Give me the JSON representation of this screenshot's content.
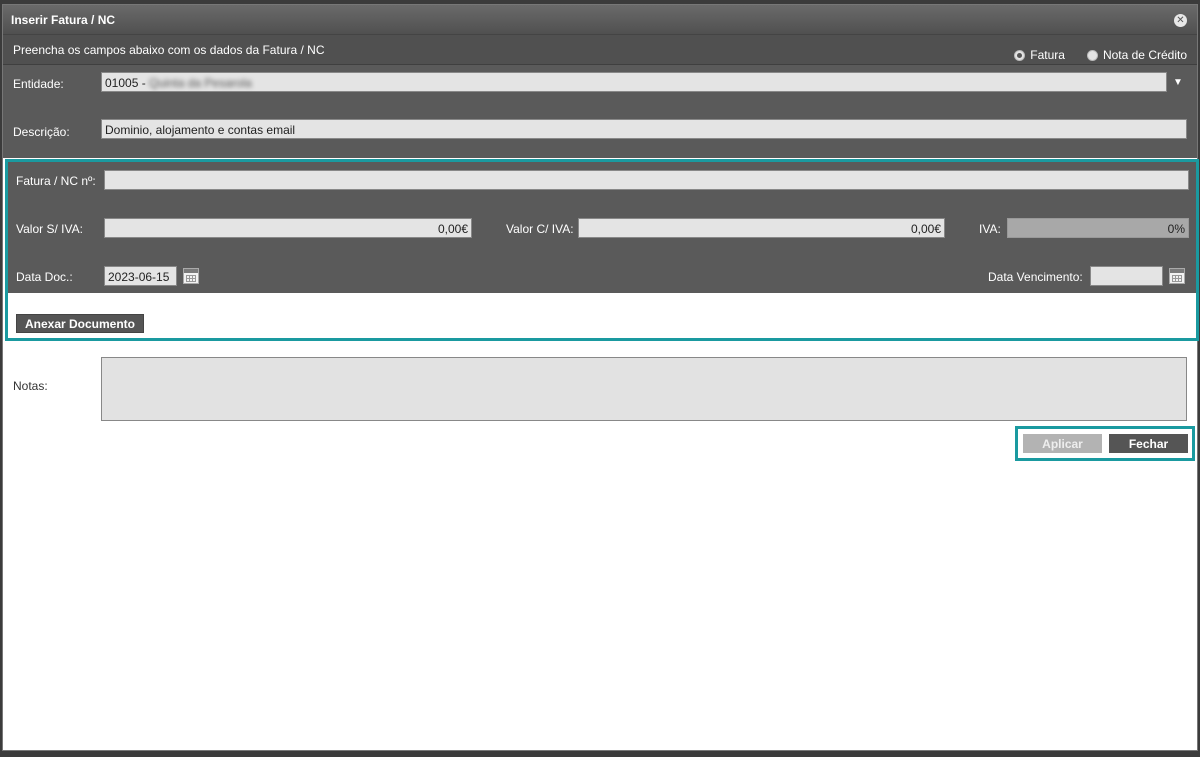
{
  "dialog": {
    "title": "Inserir Fatura / NC",
    "close_symbol": "✕"
  },
  "header": {
    "instructions": "Preencha os campos abaixo com os dados da Fatura / NC",
    "radio_options": [
      {
        "label": "Fatura",
        "selected": true
      },
      {
        "label": "Nota de Crédito",
        "selected": false
      }
    ]
  },
  "entity": {
    "label": "Entidade:",
    "code": "01005 -",
    "name_redacted": "Quinta da Pesarola"
  },
  "description": {
    "label": "Descrição:",
    "value": "Dominio, alojamento e contas email"
  },
  "invoice": {
    "number_label": "Fatura / NC nº:",
    "number_value": "",
    "value_excl_label": "Valor S/ IVA:",
    "value_excl": "0,00€",
    "value_incl_label": "Valor C/ IVA:",
    "value_incl": "0,00€",
    "vat_label": "IVA:",
    "vat_value": "0%",
    "doc_date_label": "Data Doc.:",
    "doc_date": "2023-06-15",
    "due_date_label": "Data Vencimento:",
    "due_date": "",
    "attach_label": "Anexar Documento"
  },
  "notes": {
    "label": "Notas:",
    "value": ""
  },
  "actions": {
    "apply_label": "Aplicar",
    "close_label": "Fechar"
  },
  "colors": {
    "highlight": "#1a9aa0",
    "panel": "#5a5a5a"
  }
}
